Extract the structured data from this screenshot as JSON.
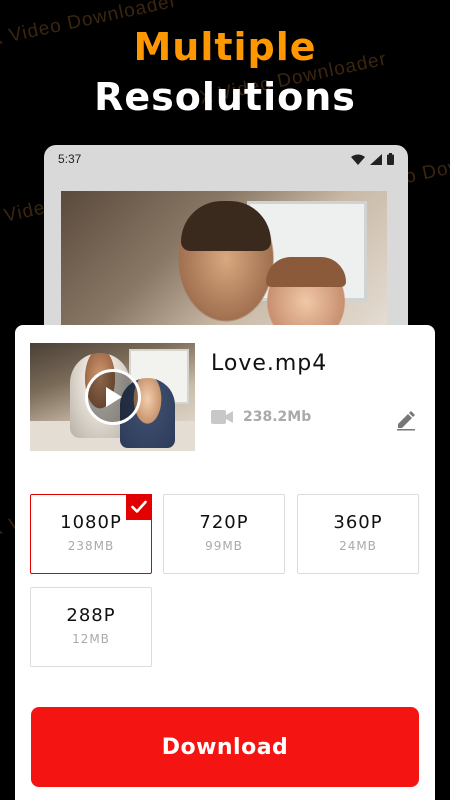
{
  "watermark_text": "X Video Downloader",
  "headline": {
    "line1": "Multiple",
    "line2": "Resolutions",
    "line1_color": "#ff9800",
    "line2_color": "#ffffff"
  },
  "phone": {
    "status_time": "5:37",
    "status_icons": [
      "wifi-icon",
      "signal-icon",
      "battery-icon"
    ]
  },
  "file": {
    "title": "Love.mp4",
    "size": "238.2Mb",
    "icons": [
      "play-icon",
      "video-camera-icon",
      "edit-pencil-icon"
    ]
  },
  "resolutions": [
    {
      "label": "1080P",
      "size": "238MB",
      "selected": true
    },
    {
      "label": "720P",
      "size": "99MB",
      "selected": false
    },
    {
      "label": "360P",
      "size": "24MB",
      "selected": false
    },
    {
      "label": "288P",
      "size": "12MB",
      "selected": false
    }
  ],
  "download_button": {
    "label": "Download",
    "color": "#f41411"
  },
  "colors": {
    "accent": "#e30000",
    "background": "#000000"
  }
}
